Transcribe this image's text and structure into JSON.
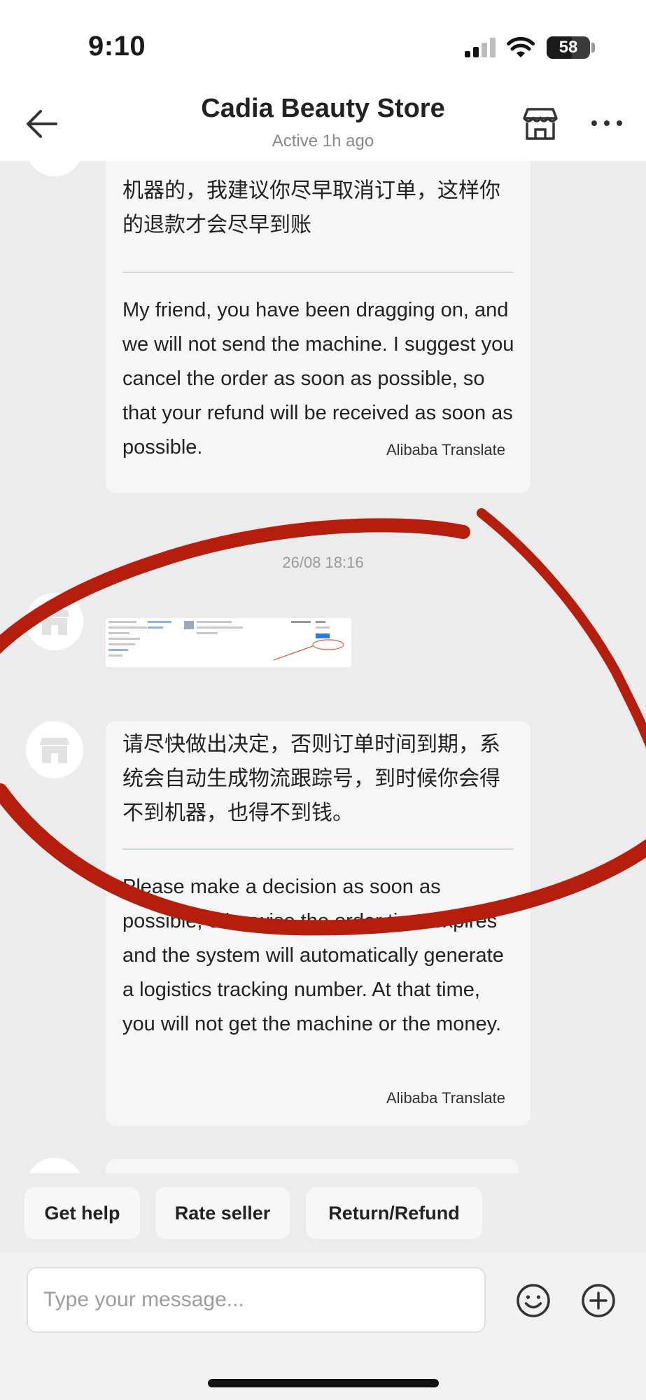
{
  "status_bar": {
    "time": "9:10",
    "battery_level": "58",
    "battery_fraction": 0.58
  },
  "header": {
    "title": "Cadia Beauty Store",
    "subtitle": "Active 1h ago",
    "icons": [
      "back-arrow-icon",
      "store-icon",
      "more-dots-icon"
    ]
  },
  "messages": [
    {
      "zh": "机器的，我建议你尽早取消订单，这样你的退款才会尽早到账",
      "en": "My friend, you have been dragging on, and we will not send the machine. I suggest you cancel the order as soon as possible, so that your refund will be received as soon as possible.",
      "source": "Alibaba Translate"
    },
    {
      "zh": "请尽快做出决定，否则订单时间到期，系统会自动生成物流跟踪号，到时候你会得不到机器，也得不到钱。",
      "en": "Please make a decision as soon as possible, otherwise the order time expires and the system will automatically generate a logistics tracking number. At that time, you will not get the machine or the money.",
      "source": "Alibaba Translate"
    }
  ],
  "timestamp": "26/08 18:16",
  "quick_actions": [
    "Get help",
    "Rate seller",
    "Return/Refund"
  ],
  "composer": {
    "placeholder": "Type your message...",
    "icons": [
      "emoji-icon",
      "add-icon"
    ]
  },
  "colors": {
    "annotation": "#b51d0c",
    "bubble": "#f6f6f6",
    "background": "#ececec"
  }
}
